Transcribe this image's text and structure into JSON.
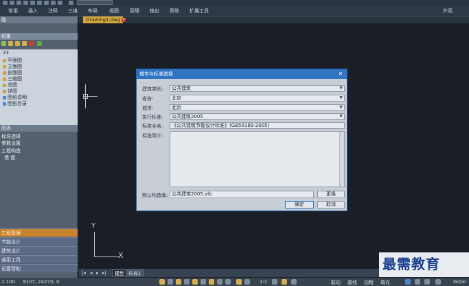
{
  "menubar": {
    "items": [
      "常用",
      "插入",
      "注释",
      "三维",
      "布局",
      "视图",
      "管理",
      "输出",
      "帮助",
      "扩展工具"
    ],
    "right_label": "外观"
  },
  "sidebar": {
    "header_top": "能",
    "section_label": "纸集",
    "tree_root": "23",
    "tree_items": [
      "平面图",
      "立面图",
      "剖面图",
      "三维图",
      "总图",
      "详图",
      "图纸说明",
      "图纸目录"
    ],
    "list_header": "图表",
    "list_items": [
      "标准选择",
      "参数设置",
      "工程构造",
      "墙  面"
    ],
    "nav_buttons": [
      "工程管理",
      "节能设计",
      "建筑设计",
      "通用工具",
      "设置帮助"
    ]
  },
  "document": {
    "tab_label": "Drawing1.dwg"
  },
  "ucs": {
    "y_label": "Y",
    "x_label": "X"
  },
  "layout_tabs": [
    "模型",
    "布局1"
  ],
  "status": {
    "scale": "1:100",
    "coords": "9107, 24270, 0",
    "ratio": "1:1",
    "toggles": [
      "联动",
      "基线",
      "加粗",
      "填充"
    ],
    "right_label": "Gstar"
  },
  "dialog": {
    "title": "城市与标准选择",
    "fields": [
      {
        "label": "建筑类别:",
        "value": "公共建筑"
      },
      {
        "label": "省份:",
        "value": "北京"
      },
      {
        "label": "城市:",
        "value": "北京"
      },
      {
        "label": "执行标准:",
        "value": "公共建筑2005"
      },
      {
        "label": "标准全名:",
        "value": "《公共建筑节能设计标准》(GB50189-2005)"
      }
    ],
    "intro_label": "标准简介:",
    "library_label": "默认构造库:",
    "library_value": "公共建筑2005.vlb",
    "change_button": "更换",
    "ok_button": "确定",
    "cancel_button": "取消"
  },
  "watermark": "最需教育"
}
